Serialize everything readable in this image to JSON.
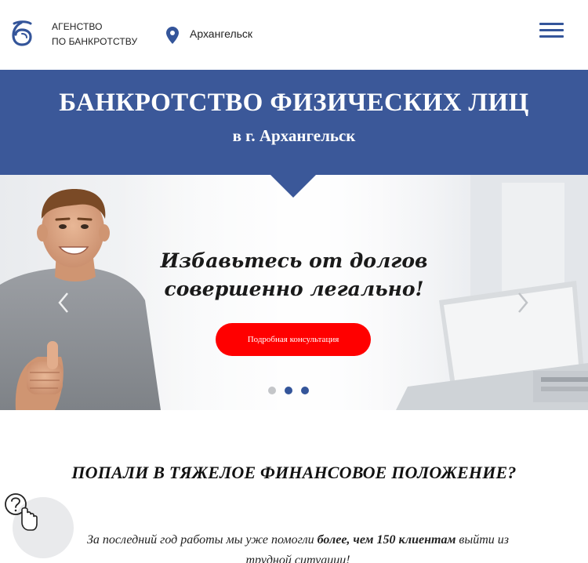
{
  "header": {
    "logo_line1": "АГЕНСТВО",
    "logo_line2": "ПО БАНКРОТСТВУ",
    "city": "Архангельск",
    "menu_icon": "hamburger-menu-icon",
    "location_icon": "map-pin-icon"
  },
  "banner": {
    "title": "БАНКРОТСТВО ФИЗИЧЕСКИХ ЛИЦ",
    "subtitle": "в г. Архангельск"
  },
  "hero": {
    "title_line1": "Избавьтесь от долгов",
    "title_line2": "совершенно легально!",
    "cta_label": "Подробная консультация",
    "slides": [
      {
        "active": false
      },
      {
        "active": true
      },
      {
        "active": true
      }
    ]
  },
  "section": {
    "title": "ПОПАЛИ В ТЯЖЕЛОЕ ФИНАНСОВОЕ ПОЛОЖЕНИЕ?",
    "text_before": "За последний год работы мы уже помогли ",
    "text_bold": "более, чем 150 клиентам",
    "text_after": " выйти из трудной ситуации!"
  },
  "colors": {
    "brand_blue": "#3b5899",
    "cta_red": "#ff0000",
    "dot_active": "#34559a",
    "dot_inactive": "#c4c6c9"
  }
}
